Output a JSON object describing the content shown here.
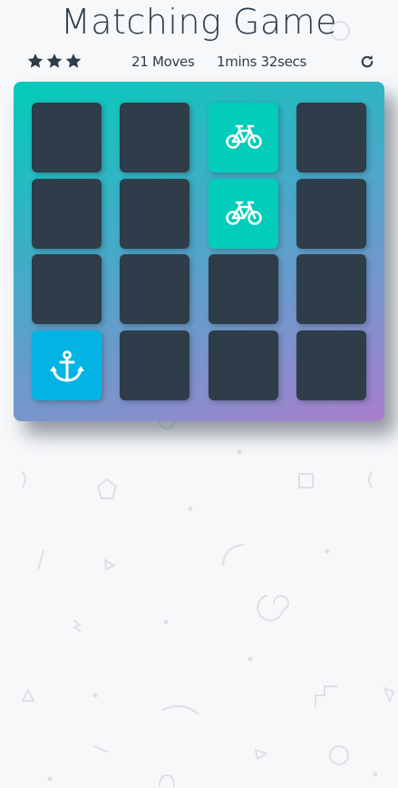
{
  "header": {
    "title": "Matching Game"
  },
  "score_panel": {
    "stars": [
      "star-icon",
      "star-icon",
      "star-icon"
    ],
    "moves_text": "21 Moves",
    "timer_text": "1mins 32secs",
    "restart_icon": "restart-icon"
  },
  "deck": {
    "colors": {
      "card_closed": "#2e3d49",
      "card_match": "#02ccba",
      "card_open": "#02b3e4"
    },
    "cards": [
      {
        "state": "closed",
        "icon": ""
      },
      {
        "state": "closed",
        "icon": ""
      },
      {
        "state": "match",
        "icon": "bicycle-icon"
      },
      {
        "state": "closed",
        "icon": ""
      },
      {
        "state": "closed",
        "icon": ""
      },
      {
        "state": "closed",
        "icon": ""
      },
      {
        "state": "match",
        "icon": "bicycle-icon"
      },
      {
        "state": "closed",
        "icon": ""
      },
      {
        "state": "closed",
        "icon": ""
      },
      {
        "state": "closed",
        "icon": ""
      },
      {
        "state": "closed",
        "icon": ""
      },
      {
        "state": "closed",
        "icon": ""
      },
      {
        "state": "open",
        "icon": "anchor-icon"
      },
      {
        "state": "closed",
        "icon": ""
      },
      {
        "state": "closed",
        "icon": ""
      },
      {
        "state": "closed",
        "icon": ""
      }
    ]
  }
}
